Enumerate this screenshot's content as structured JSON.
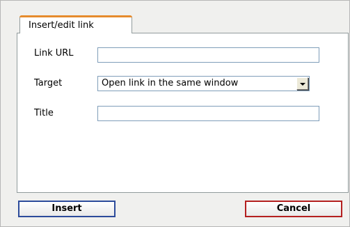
{
  "dialog": {
    "tab_label": "Insert/edit link"
  },
  "form": {
    "link_url": {
      "label": "Link URL",
      "value": ""
    },
    "target": {
      "label": "Target",
      "selected": "Open link in the same window"
    },
    "title": {
      "label": "Title",
      "value": ""
    }
  },
  "buttons": {
    "insert_label": "Insert",
    "cancel_label": "Cancel"
  },
  "colors": {
    "tab_accent": "#e68b2c",
    "insert_border": "#2c4b9b",
    "cancel_border": "#b41f1f",
    "input_border": "#7f9db9"
  },
  "icons": {
    "select_arrow": "chevron-down-icon"
  }
}
